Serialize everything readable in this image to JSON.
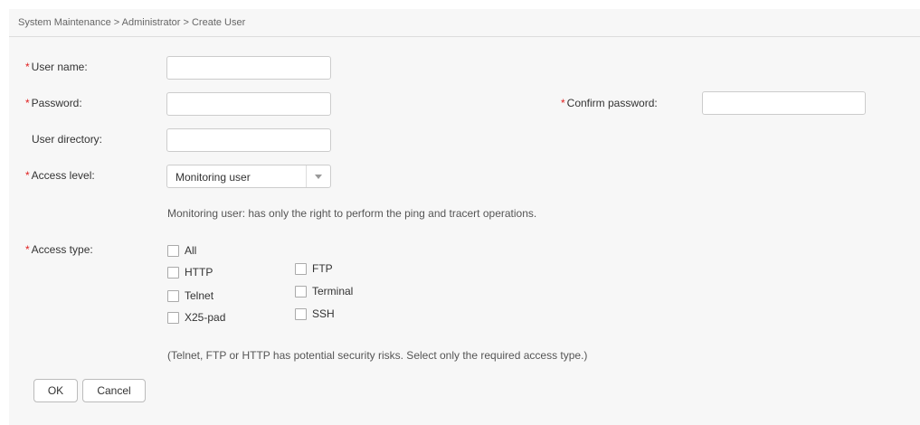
{
  "breadcrumb": "System Maintenance > Administrator > Create User",
  "required_mark": "*",
  "form": {
    "username_label": "User name:",
    "username_value": "",
    "password_label": "Password:",
    "password_value": "",
    "confirm_password_label": "Confirm password:",
    "confirm_password_value": "",
    "user_directory_label": "User directory:",
    "user_directory_value": "",
    "access_level_label": "Access level:",
    "access_level_value": "Monitoring user",
    "access_level_hint": "Monitoring user: has only the right to perform the ping and tracert operations.",
    "access_type_label": "Access type:",
    "access_types": {
      "all": {
        "label": "All",
        "checked": false
      },
      "http": {
        "label": "HTTP",
        "checked": false
      },
      "ftp": {
        "label": "FTP",
        "checked": false
      },
      "telnet": {
        "label": "Telnet",
        "checked": false
      },
      "terminal": {
        "label": "Terminal",
        "checked": false
      },
      "x25pad": {
        "label": "X25-pad",
        "checked": false
      },
      "ssh": {
        "label": "SSH",
        "checked": false
      }
    },
    "security_note": "(Telnet, FTP or HTTP has potential security risks. Select only the required access type.)"
  },
  "buttons": {
    "ok": "OK",
    "cancel": "Cancel"
  },
  "colors": {
    "required": "#e02020",
    "panel_background": "#f7f7f7"
  },
  "icons": {
    "access_level_dropdown": "chevron-down-icon"
  }
}
